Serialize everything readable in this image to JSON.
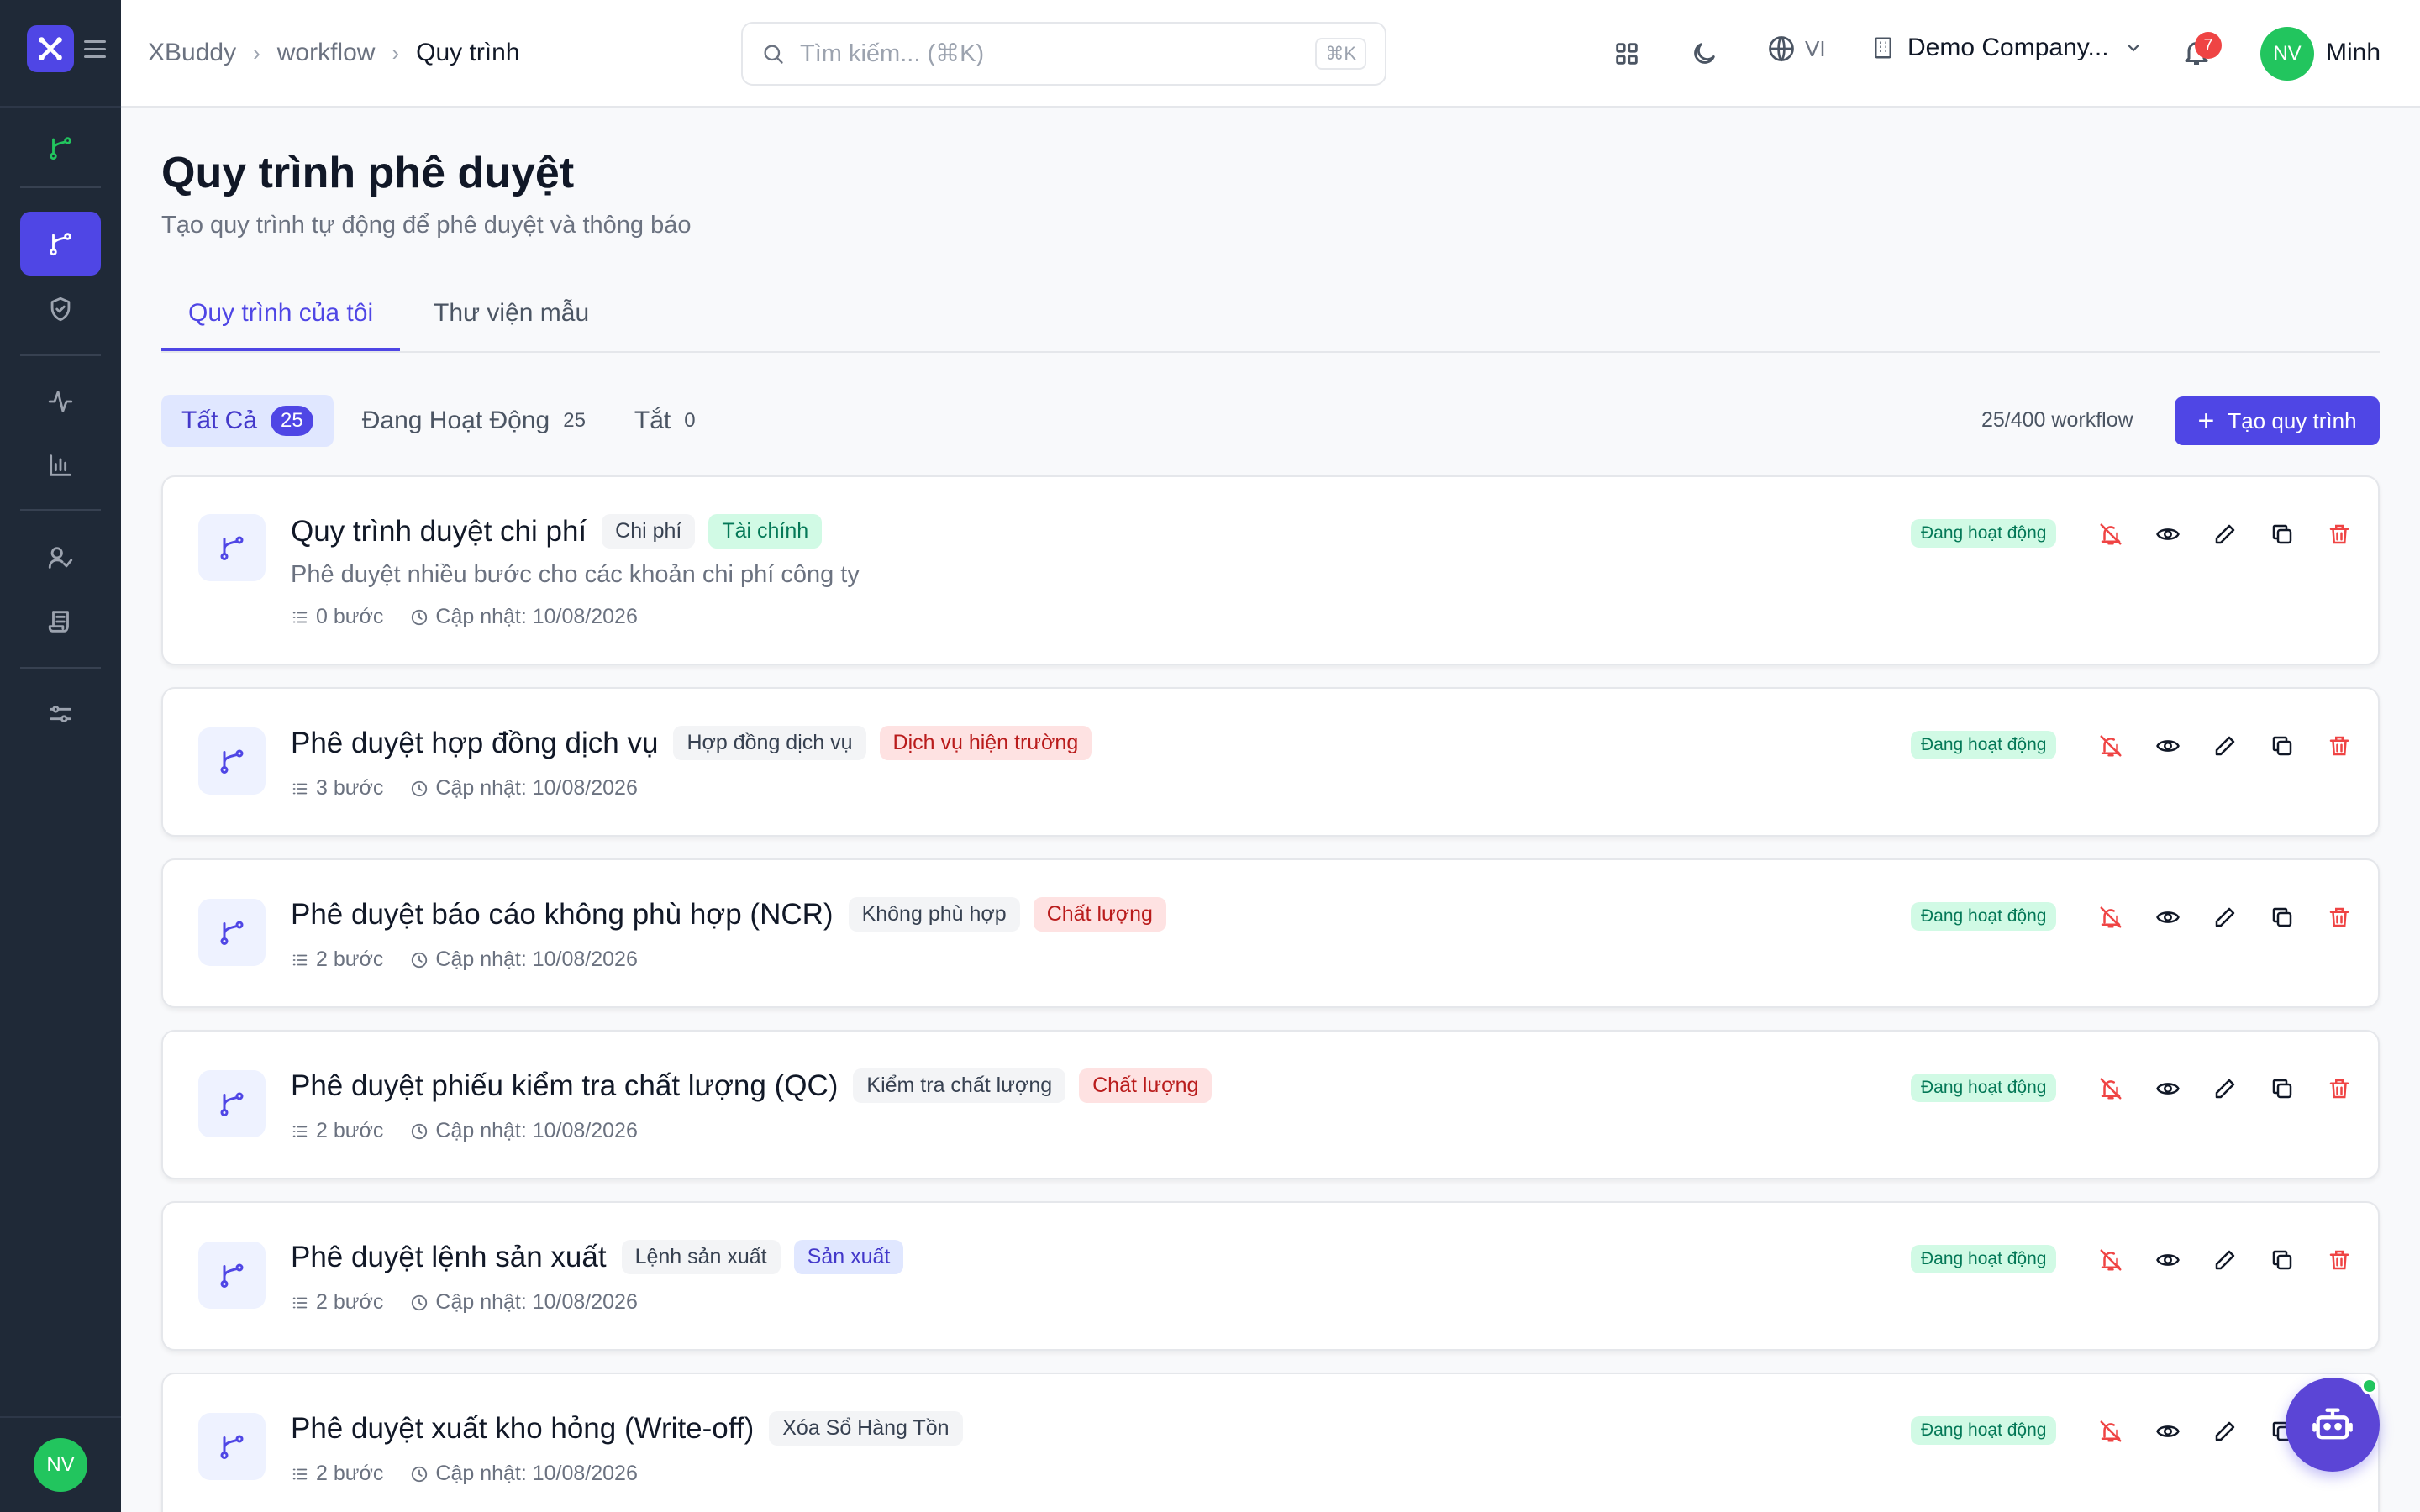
{
  "breadcrumb": [
    "XBuddy",
    "workflow",
    "Quy trình"
  ],
  "search": {
    "placeholder": "Tìm kiếm... (⌘K)",
    "shortcut": "⌘K"
  },
  "header": {
    "lang": "VI",
    "company": "Demo Company...",
    "notifications": "7",
    "user_initials": "NV",
    "user_name": "Minh"
  },
  "sidebar": {
    "avatar": "NV"
  },
  "page": {
    "title": "Quy trình phê duyệt",
    "subtitle": "Tạo quy trình tự động để phê duyệt và thông báo"
  },
  "tabs": [
    "Quy trình của tôi",
    "Thư viện mẫu"
  ],
  "filters": [
    {
      "label": "Tất Cả",
      "count": "25"
    },
    {
      "label": "Đang Hoạt Động",
      "count": "25"
    },
    {
      "label": "Tắt",
      "count": "0"
    }
  ],
  "quota": "25/400 workflow",
  "create_button": "Tạo quy trình",
  "workflows": [
    {
      "title": "Quy trình duyệt chi phí",
      "tags": [
        {
          "text": "Chi phí",
          "color": "gray"
        },
        {
          "text": "Tài chính",
          "color": "green"
        }
      ],
      "description": "Phê duyệt nhiều bước cho các khoản chi phí công ty",
      "steps": "0 bước",
      "updated": "Cập nhật: 10/08/2026",
      "status": "Đang hoạt động"
    },
    {
      "title": "Phê duyệt hợp đồng dịch vụ",
      "tags": [
        {
          "text": "Hợp đồng dịch vụ",
          "color": "gray"
        },
        {
          "text": "Dịch vụ hiện trường",
          "color": "red"
        }
      ],
      "description": "",
      "steps": "3 bước",
      "updated": "Cập nhật: 10/08/2026",
      "status": "Đang hoạt động"
    },
    {
      "title": "Phê duyệt báo cáo không phù hợp (NCR)",
      "tags": [
        {
          "text": "Không phù hợp",
          "color": "gray"
        },
        {
          "text": "Chất lượng",
          "color": "red"
        }
      ],
      "description": "",
      "steps": "2 bước",
      "updated": "Cập nhật: 10/08/2026",
      "status": "Đang hoạt động"
    },
    {
      "title": "Phê duyệt phiếu kiểm tra chất lượng (QC)",
      "tags": [
        {
          "text": "Kiểm tra chất lượng",
          "color": "gray"
        },
        {
          "text": "Chất lượng",
          "color": "red"
        }
      ],
      "description": "",
      "steps": "2 bước",
      "updated": "Cập nhật: 10/08/2026",
      "status": "Đang hoạt động"
    },
    {
      "title": "Phê duyệt lệnh sản xuất",
      "tags": [
        {
          "text": "Lệnh sản xuất",
          "color": "gray"
        },
        {
          "text": "Sản xuất",
          "color": "indigo"
        }
      ],
      "description": "",
      "steps": "2 bước",
      "updated": "Cập nhật: 10/08/2026",
      "status": "Đang hoạt động"
    },
    {
      "title": "Phê duyệt xuất kho hỏng (Write-off)",
      "tags": [
        {
          "text": "Xóa Sổ Hàng Tồn",
          "color": "gray"
        }
      ],
      "description": "",
      "steps": "2 bước",
      "updated": "Cập nhật: 10/08/2026",
      "status": "Đang hoạt động"
    }
  ],
  "colors": {
    "accent": "#4f46e5",
    "sidebar": "#1f2937",
    "success": "#22c55e",
    "danger": "#ef4444"
  }
}
